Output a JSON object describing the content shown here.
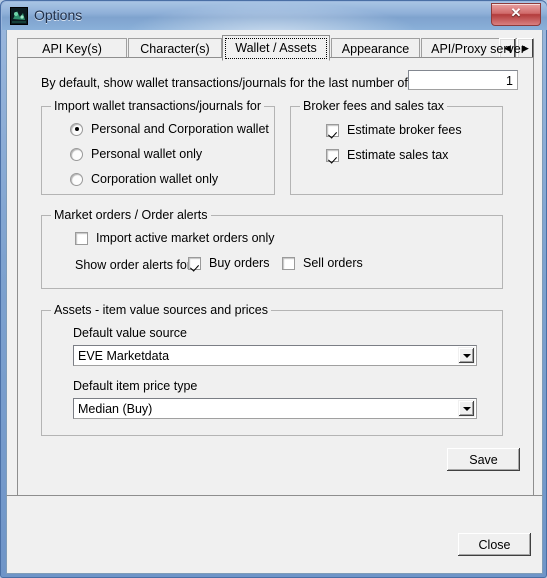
{
  "window": {
    "title": "Options",
    "app_icon": "app-logo-icon",
    "close_button_glyph": "✕",
    "close_button_name": "close-window-button"
  },
  "tabs": [
    {
      "label": "API Key(s)",
      "selected": false
    },
    {
      "label": "Character(s)",
      "selected": false
    },
    {
      "label": "Wallet / Assets",
      "selected": true
    },
    {
      "label": "Appearance",
      "selected": false
    },
    {
      "label": "API/Proxy server",
      "selected": false
    }
  ],
  "tab_scroll": {
    "left_glyph": "◀",
    "right_glyph": "▶"
  },
  "wallet_assets": {
    "default_days_label": "By default, show wallet transactions/journals for the last number of days:",
    "default_days_value": "1",
    "import_group": {
      "title": "Import wallet transactions/journals for",
      "options": [
        {
          "label": "Personal and Corporation wallet",
          "checked": true
        },
        {
          "label": "Personal wallet only",
          "checked": false
        },
        {
          "label": "Corporation wallet only",
          "checked": false
        }
      ]
    },
    "broker_group": {
      "title": "Broker fees and sales tax",
      "options": [
        {
          "label": "Estimate broker fees",
          "checked": true
        },
        {
          "label": "Estimate sales tax",
          "checked": true
        }
      ]
    },
    "market_group": {
      "title": "Market orders / Order alerts",
      "import_active_label": "Import active market orders only",
      "import_active_checked": false,
      "show_alerts_label": "Show order alerts for",
      "buy_orders_label": "Buy orders",
      "buy_orders_checked": true,
      "sell_orders_label": "Sell orders",
      "sell_orders_checked": false
    },
    "assets_group": {
      "title": "Assets - item value sources and prices",
      "value_source_label": "Default value source",
      "value_source_selected": "EVE Marketdata",
      "price_type_label": "Default item price type",
      "price_type_selected": "Median (Buy)"
    },
    "save_label": "Save"
  },
  "footer": {
    "close_label": "Close"
  },
  "colors": {
    "titlebar_accent": "#8fb0d8",
    "frame_border": "#4a6fa5",
    "dialog_face": "#f0f0f0",
    "close_button_red": "#b23b3b",
    "group_border": "#b4b4b4"
  }
}
